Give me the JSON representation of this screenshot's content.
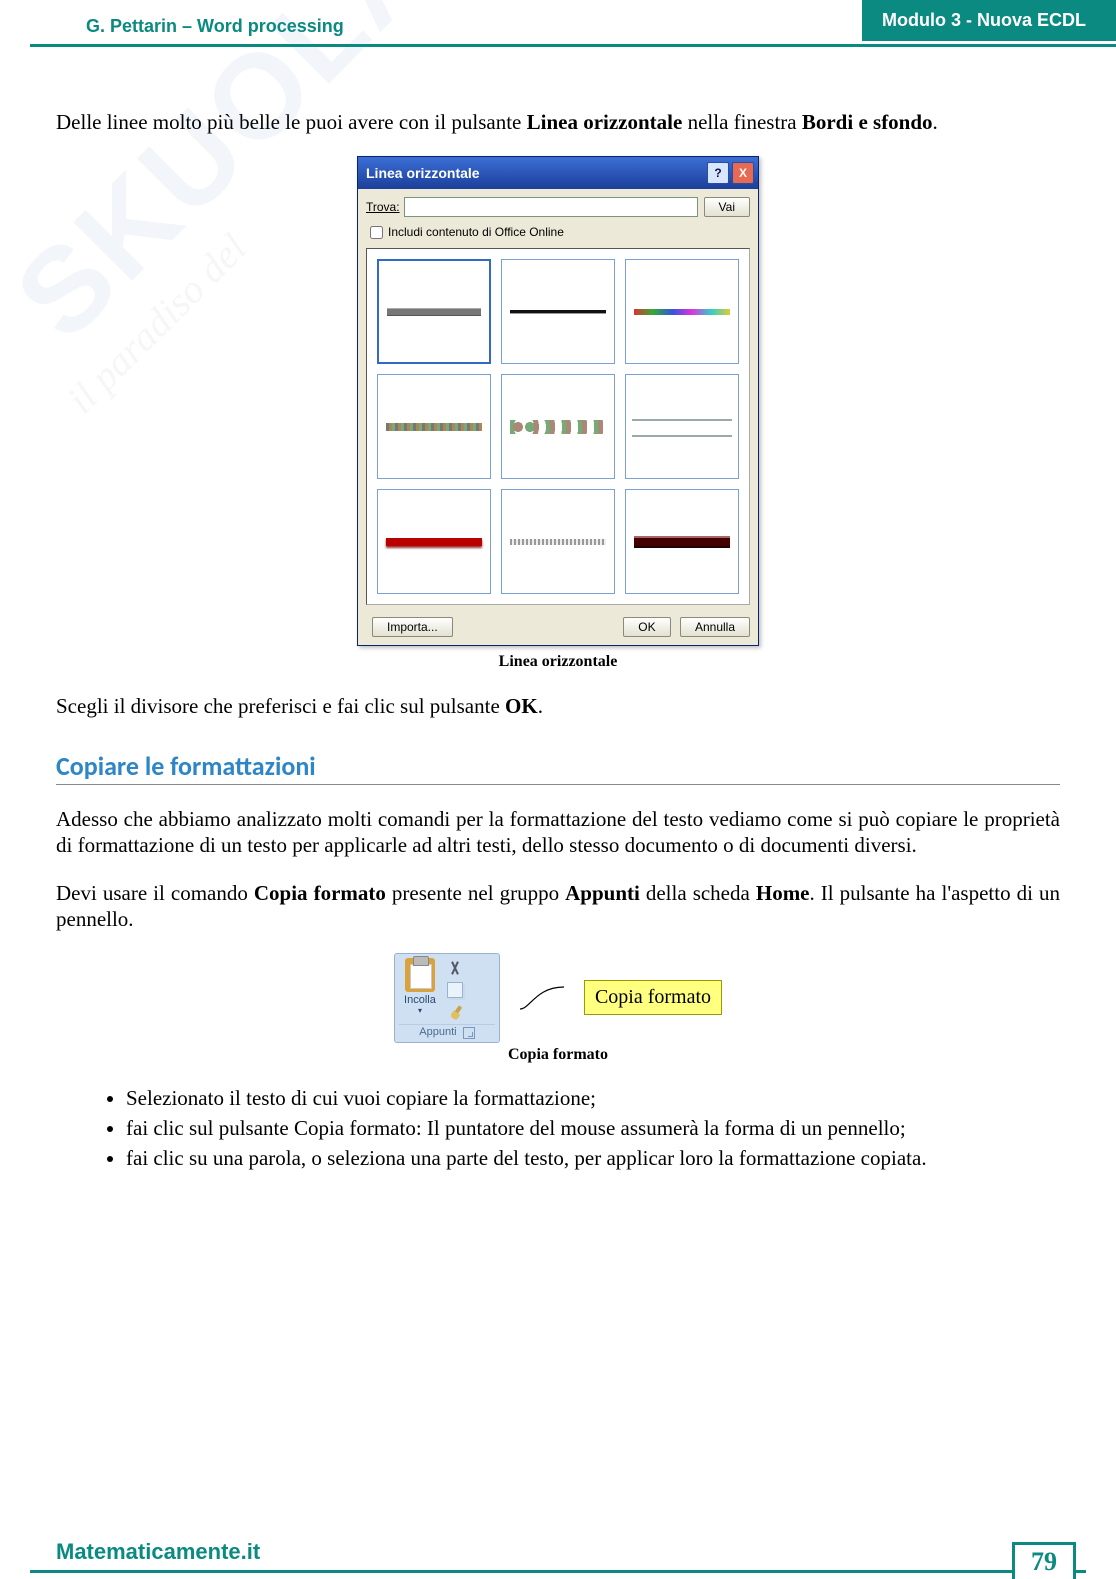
{
  "header": {
    "left": "G. Pettarin – Word processing",
    "right": "Modulo 3 - Nuova ECDL"
  },
  "para1_a": "Delle linee molto più belle le puoi avere con il pulsante ",
  "para1_b": "Linea orizzontale",
  "para1_c": " nella finestra ",
  "para1_d": "Bordi e sfondo",
  "para1_e": ".",
  "dialog": {
    "title": "Linea orizzontale",
    "help": "?",
    "close": "X",
    "find_label": "Trova:",
    "find_value": "",
    "go": "Vai",
    "include": "Includi contenuto di Office Online",
    "import": "Importa...",
    "ok": "OK",
    "cancel": "Annulla"
  },
  "caption1": "Linea orizzontale",
  "para2_a": "Scegli il divisore che preferisci e fai clic sul pulsante ",
  "para2_b": "OK",
  "para2_c": ".",
  "section_title": "Copiare le formattazioni",
  "para3": "Adesso che abbiamo analizzato molti comandi per la formattazione del testo vediamo come si può copiare le proprietà di formattazione di un testo per applicarle ad altri testi, dello stesso documento o di documenti diversi.",
  "para4_a": "Devi usare il comando ",
  "para4_b": "Copia formato",
  "para4_c": " presente nel gruppo ",
  "para4_d": "Appunti",
  "para4_e": " della scheda ",
  "para4_f": "Home",
  "para4_g": ". Il pulsante ha l'aspetto di un pennello.",
  "ribbon": {
    "paste": "Incolla",
    "group": "Appunti",
    "callout": "Copia formato"
  },
  "caption2": "Copia formato",
  "bullets": [
    "Selezionato il testo di cui vuoi copiare la formattazione;",
    "fai clic sul pulsante Copia formato: Il puntatore del mouse assumerà la forma di un pennello;",
    "fai clic su una parola, o seleziona una parte del testo, per applicar loro la formattazione copiata."
  ],
  "footer": {
    "site": "Matematicamente.it",
    "page": "79"
  },
  "watermark": {
    "brand": "SKUOLA",
    "tag": "il paradiso del"
  }
}
